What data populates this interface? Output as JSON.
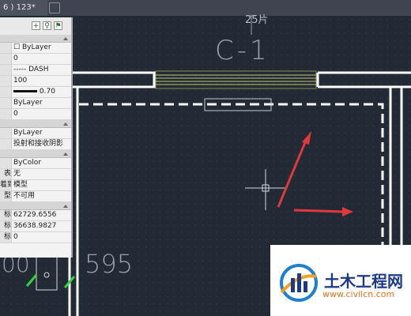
{
  "tab": {
    "title": "6 ) 123*"
  },
  "drawing": {
    "label_top": "25片",
    "label_main": "C-1",
    "label_bottom": "595",
    "label_bottom_left": "00"
  },
  "properties": {
    "rows": [
      {
        "key": "",
        "value": "ByLayer"
      },
      {
        "key": "",
        "value": "0"
      },
      {
        "key": "",
        "value": "DASH"
      },
      {
        "key": "",
        "value": "100"
      },
      {
        "key": "",
        "value": "0.70"
      },
      {
        "key": "",
        "value": "ByLayer"
      },
      {
        "key": "",
        "value": "0"
      },
      {
        "key": "",
        "value": "ByLayer"
      },
      {
        "key": "",
        "value": "投射和接收阴影"
      },
      {
        "key": "",
        "value": "ByColor"
      },
      {
        "key": "表",
        "value": "无"
      },
      {
        "key": "着到",
        "value": "模型"
      },
      {
        "key": "型",
        "value": "不可用"
      },
      {
        "key": "标",
        "value": "62729.6556"
      },
      {
        "key": "标",
        "value": "36638.9827"
      },
      {
        "key": "标",
        "value": "0"
      }
    ]
  },
  "watermark": {
    "text": "土木工程网",
    "url": "www.civilcn.com"
  },
  "colors": {
    "canvas": "#222a36",
    "arrow": "#e0383b",
    "wall": "#ffffff",
    "yellow": "#c8c66a",
    "green": "#35d23c"
  }
}
